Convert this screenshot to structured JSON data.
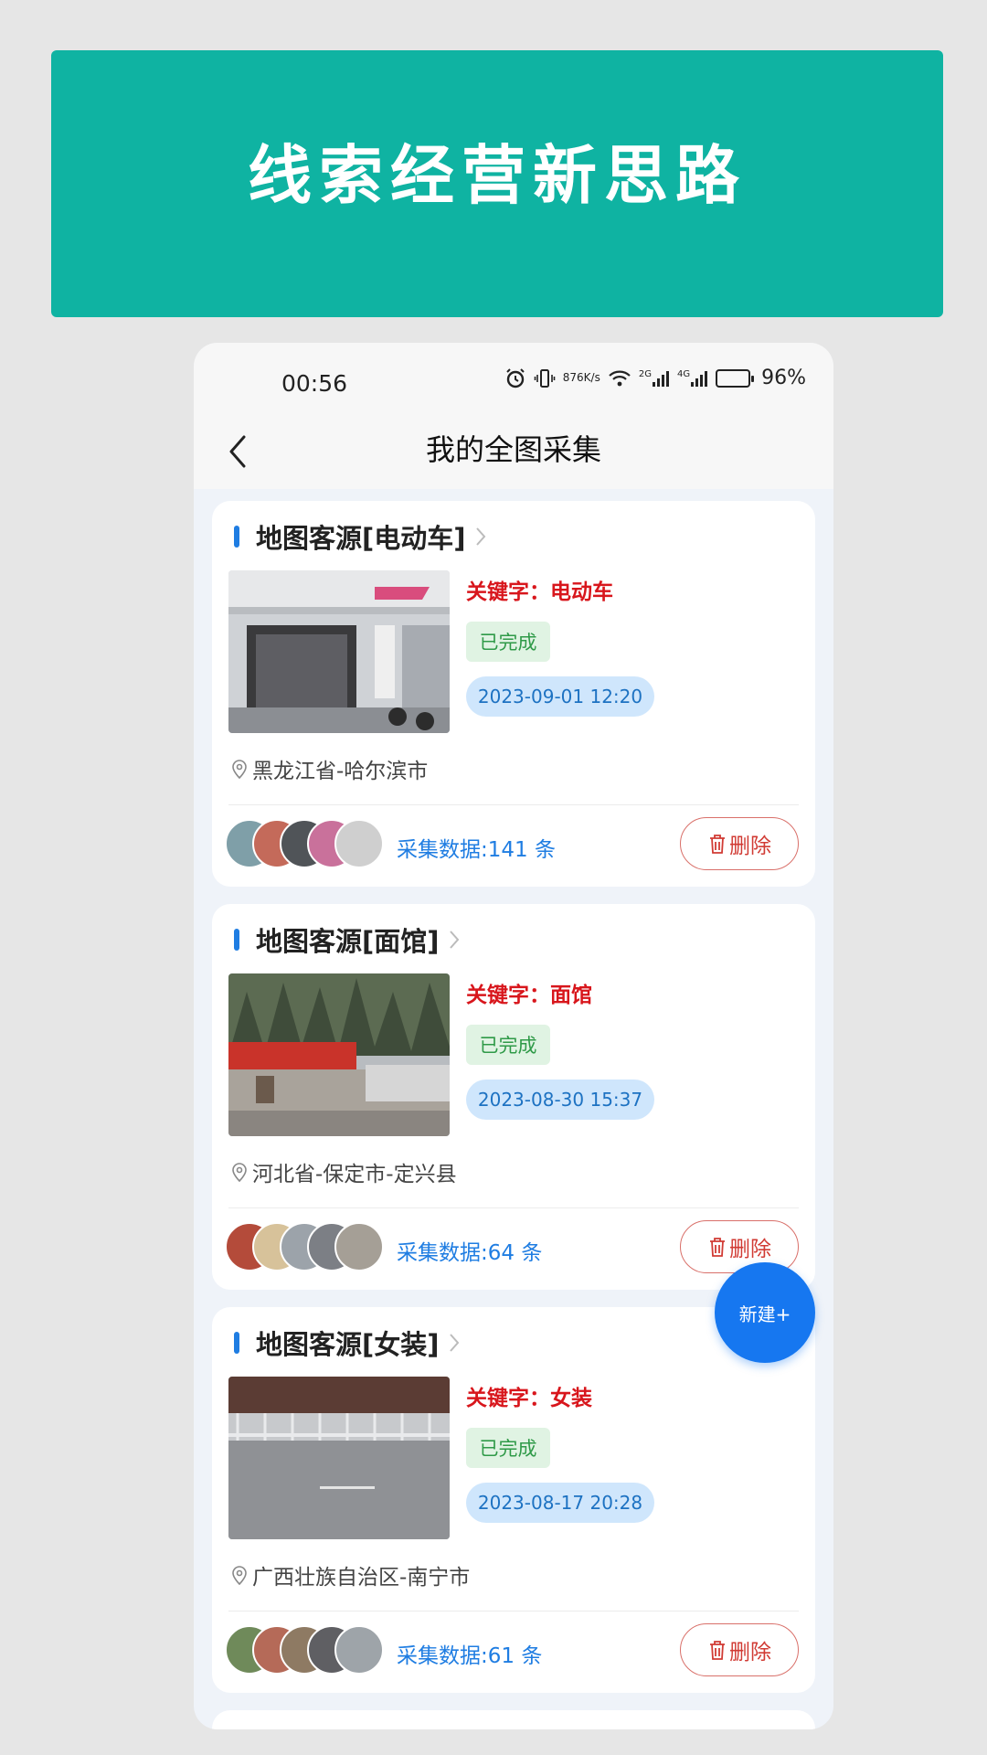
{
  "banner": {
    "title": "线索经营新思路"
  },
  "status_bar": {
    "time": "00:56",
    "net_speed_value": "876",
    "net_speed_unit": "K/s",
    "signal1": "2G",
    "signal2": "4G",
    "battery": "96%"
  },
  "header": {
    "title": "我的全图采集"
  },
  "cards": [
    {
      "title": "地图客源[电动车]",
      "keyword": "关键字：电动车",
      "status": "已完成",
      "date": "2023-09-01 12:20",
      "location": "黑龙江省-哈尔滨市",
      "count": "采集数据:141 条",
      "delete_label": "删除"
    },
    {
      "title": "地图客源[面馆]",
      "keyword": "关键字：面馆",
      "status": "已完成",
      "date": "2023-08-30 15:37",
      "location": "河北省-保定市-定兴县",
      "count": "采集数据:64 条",
      "delete_label": "删除"
    },
    {
      "title": "地图客源[女装]",
      "keyword": "关键字：女装",
      "status": "已完成",
      "date": "2023-08-17 20:28",
      "location": "广西壮族自治区-南宁市",
      "count": "采集数据:61 条",
      "delete_label": "删除"
    }
  ],
  "fab": {
    "label": "新建+"
  },
  "colors": {
    "banner": "#0fb3a2",
    "accent_blue": "#1f7de2",
    "keyword_red": "#d8161c",
    "status_green": "#2f9a48",
    "fab_blue": "#1677f0"
  }
}
